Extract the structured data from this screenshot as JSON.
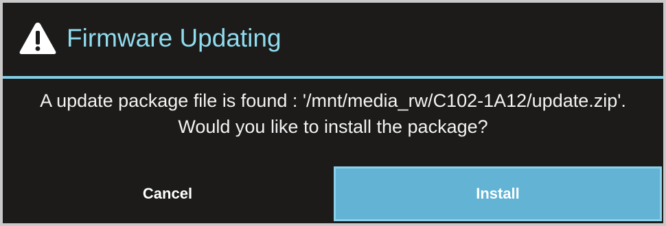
{
  "dialog": {
    "title": "Firmware Updating",
    "title_icon": "warning-icon",
    "message": "A update package file is found : '/mnt/media_rw/C102-1A12/update.zip'. Would you like to install the package?",
    "buttons": {
      "cancel_label": "Cancel",
      "install_label": "Install"
    },
    "colors": {
      "background": "#1c1b19",
      "accent": "#82cfe6",
      "title": "#8fdcef",
      "primary_button": "#62b3d4",
      "text": "#f3f3f3"
    }
  }
}
